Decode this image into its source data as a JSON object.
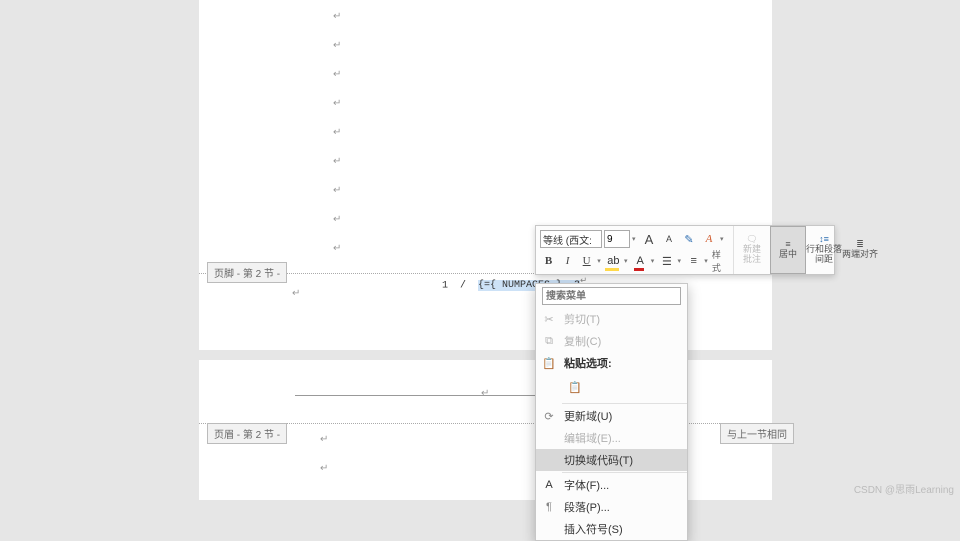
{
  "section_tabs": {
    "footer": "页脚 - 第 2 节 -",
    "header": "页眉 - 第 2 节 -",
    "link_prev": "与上一节相同"
  },
  "footer": {
    "field_text": "1 / {={ NUMPAGES } -3",
    "selection_start": 4,
    "selection_end": 24
  },
  "mini_toolbar": {
    "font": "等线 (西文:",
    "size": "9",
    "grow": "A",
    "shrink": "A",
    "bold": "B",
    "italic": "I",
    "underline": "U",
    "styles_label": "样式",
    "comment_label": "新建\n批注",
    "align_center": "居中",
    "line_spacing": "行和段落\n间距",
    "justify": "两端对齐"
  },
  "context_menu": {
    "search_placeholder": "搜索菜单",
    "cut": "剪切(T)",
    "copy": "复制(C)",
    "paste_header": "粘贴选项:",
    "update_field": "更新域(U)",
    "edit_field": "编辑域(E)...",
    "toggle_field": "切换域代码(T)",
    "font": "字体(F)...",
    "paragraph": "段落(P)...",
    "symbol": "插入符号(S)"
  },
  "credit": "CSDN @思雨Learning"
}
